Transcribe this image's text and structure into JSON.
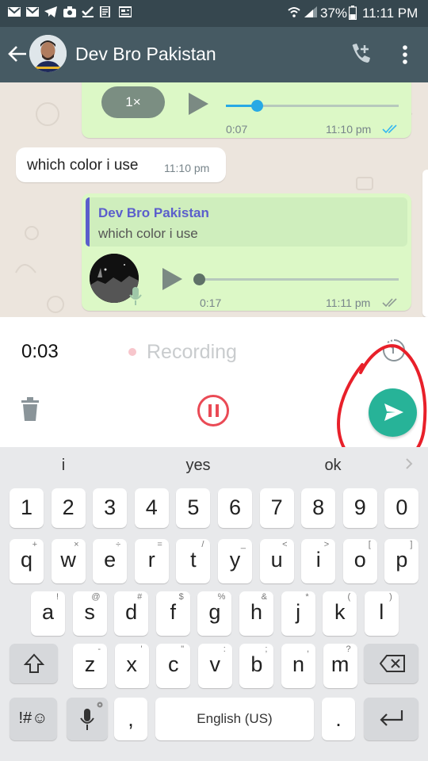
{
  "status_bar": {
    "battery": "37%",
    "time": "11:11 PM"
  },
  "header": {
    "title": "Dev Bro Pakistan"
  },
  "chat": {
    "voice1": {
      "speed": "1×",
      "duration": "0:07",
      "time": "11:10 pm",
      "progress": 0.18
    },
    "incoming": {
      "text": "which color i use",
      "time": "11:10 pm"
    },
    "reply": {
      "quote_author": "Dev Bro Pakistan",
      "quote_text": "which color i use",
      "duration": "0:17",
      "time": "11:11 pm",
      "progress": 0.0
    }
  },
  "recording": {
    "timer": "0:03",
    "label": "Recording"
  },
  "keyboard": {
    "suggestions": [
      "i",
      "yes",
      "ok"
    ],
    "num_row": [
      "1",
      "2",
      "3",
      "4",
      "5",
      "6",
      "7",
      "8",
      "9",
      "0"
    ],
    "row1": [
      {
        "k": "q",
        "h": "+"
      },
      {
        "k": "w",
        "h": "×"
      },
      {
        "k": "e",
        "h": "÷"
      },
      {
        "k": "r",
        "h": "="
      },
      {
        "k": "t",
        "h": "/"
      },
      {
        "k": "y",
        "h": "_"
      },
      {
        "k": "u",
        "h": "<"
      },
      {
        "k": "i",
        "h": ">"
      },
      {
        "k": "o",
        "h": "["
      },
      {
        "k": "p",
        "h": "]"
      }
    ],
    "row2": [
      {
        "k": "a",
        "h": "!"
      },
      {
        "k": "s",
        "h": "@"
      },
      {
        "k": "d",
        "h": "#"
      },
      {
        "k": "f",
        "h": "$"
      },
      {
        "k": "g",
        "h": "%"
      },
      {
        "k": "h",
        "h": "&"
      },
      {
        "k": "j",
        "h": "*"
      },
      {
        "k": "k",
        "h": "("
      },
      {
        "k": "l",
        "h": ")"
      }
    ],
    "row3": [
      {
        "k": "z",
        "h": "-"
      },
      {
        "k": "x",
        "h": "'"
      },
      {
        "k": "c",
        "h": "\""
      },
      {
        "k": "v",
        "h": ":"
      },
      {
        "k": "b",
        "h": ";"
      },
      {
        "k": "n",
        "h": ","
      },
      {
        "k": "m",
        "h": "?"
      }
    ],
    "symbols_label": "!#☺",
    "comma": ",",
    "space_label": "English (US)",
    "period": "."
  }
}
